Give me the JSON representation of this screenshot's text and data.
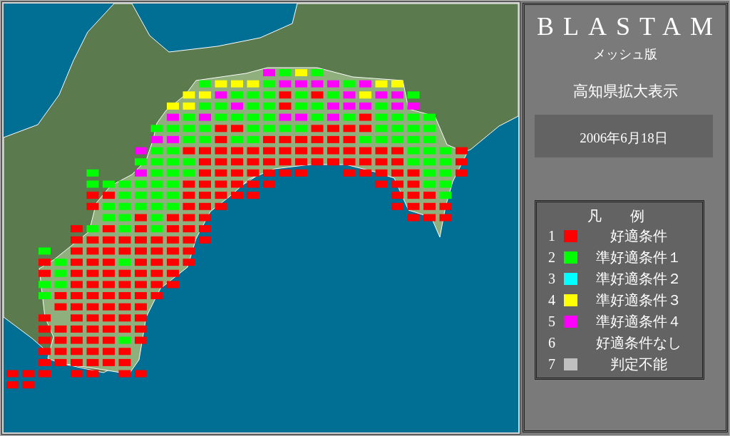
{
  "title": "BLASTAM",
  "subtitle": "メッシュ版",
  "view": "高知県拡大表示",
  "date": "2006年6月18日",
  "legend": {
    "heading": "凡　　例",
    "items": [
      {
        "number": "1",
        "color": "#ff0000",
        "label": "好適条件"
      },
      {
        "number": "2",
        "color": "#00ff00",
        "label": "準好適条件１"
      },
      {
        "number": "3",
        "color": "#00ffff",
        "label": "準好適条件２"
      },
      {
        "number": "4",
        "color": "#ffff00",
        "label": "準好適条件３"
      },
      {
        "number": "5",
        "color": "#ff00ff",
        "label": "準好適条件４"
      },
      {
        "number": "6",
        "label": "好適条件なし"
      },
      {
        "number": "7",
        "color": "#c0c0c0",
        "label": "判定不能"
      }
    ]
  }
}
